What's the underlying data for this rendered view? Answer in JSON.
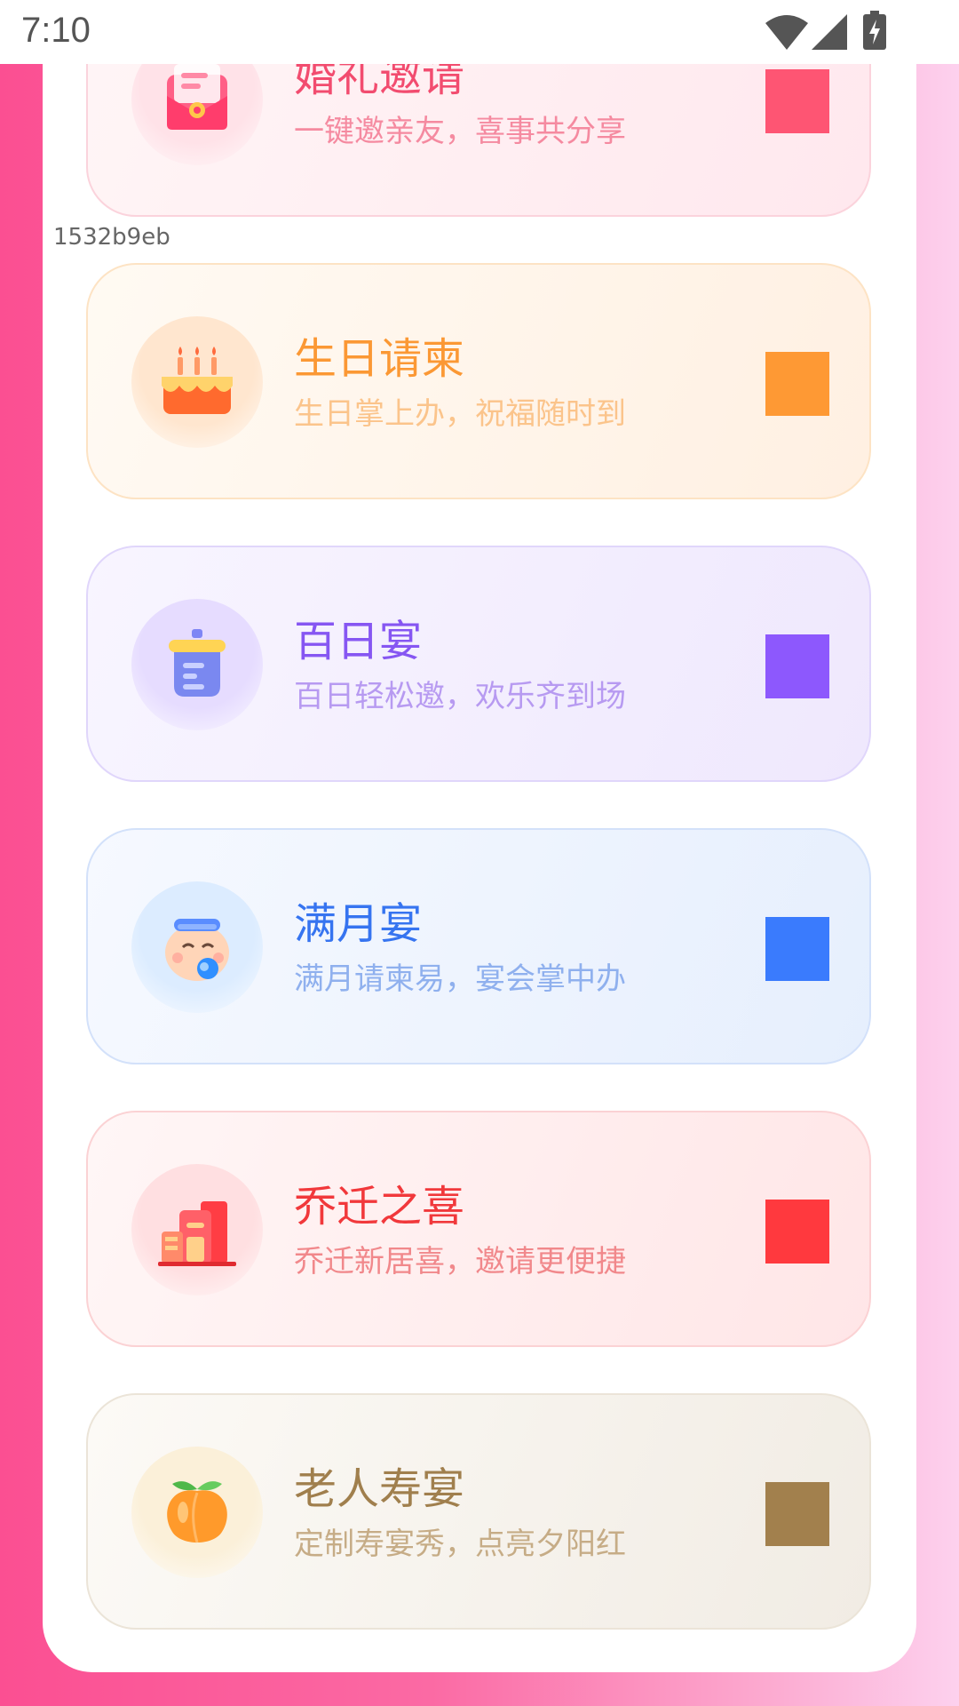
{
  "status_bar": {
    "time": "7:10"
  },
  "debug_id": "1532b9eb",
  "cards": [
    {
      "title": "婚礼邀请",
      "subtitle": "一键邀亲友，喜事共分享",
      "icon": "envelope-icon",
      "title_color": "#f24c6f",
      "subtitle_color": "#f58aa0",
      "accent": "#fe5573",
      "bg_from": "#fff5f6",
      "bg_to": "#ffe8ee",
      "border": "#fbd3dc",
      "circle": "#ffe2e8"
    },
    {
      "title": "生日请柬",
      "subtitle": "生日掌上办，祝福随时到",
      "icon": "birthday-cake-icon",
      "title_color": "#fb9834",
      "subtitle_color": "#fbc48b",
      "accent": "#fe9934",
      "bg_from": "#fffaf3",
      "bg_to": "#fff0e2",
      "border": "#fde3c4",
      "circle": "#ffe6cf"
    },
    {
      "title": "百日宴",
      "subtitle": "百日轻松邀，欢乐齐到场",
      "icon": "cooking-pot-icon",
      "title_color": "#8656f2",
      "subtitle_color": "#b79af1",
      "accent": "#8d58fd",
      "bg_from": "#f8f5ff",
      "bg_to": "#efe8fd",
      "border": "#e0d6fb",
      "circle": "#e6dcff"
    },
    {
      "title": "满月宴",
      "subtitle": "满月请柬易，宴会掌中办",
      "icon": "baby-face-icon",
      "title_color": "#3674f0",
      "subtitle_color": "#8fb0ee",
      "accent": "#3a7bfd",
      "bg_from": "#f6f9ff",
      "bg_to": "#e6effd",
      "border": "#d3e1fa",
      "circle": "#dcecff"
    },
    {
      "title": "乔迁之喜",
      "subtitle": "乔迁新居喜，邀请更便捷",
      "icon": "building-icon",
      "title_color": "#f1383b",
      "subtitle_color": "#f1888b",
      "accent": "#ff393e",
      "bg_from": "#fff6f6",
      "bg_to": "#ffe6e7",
      "border": "#fbd2d4",
      "circle": "#ffdfe1"
    },
    {
      "title": "老人寿宴",
      "subtitle": "定制寿宴秀，点亮夕阳红",
      "icon": "peach-icon",
      "title_color": "#a07f4d",
      "subtitle_color": "#c6ac86",
      "accent": "#a2804d",
      "bg_from": "#fcfaf6",
      "bg_to": "#f1ece4",
      "border": "#ebe4d8",
      "circle": "#fbf0d9"
    }
  ]
}
